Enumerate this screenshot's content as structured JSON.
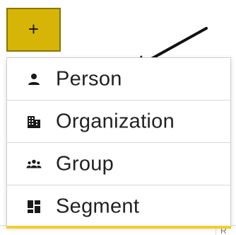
{
  "add_button": {
    "icon": "plus-icon",
    "glyph": "+",
    "color": "#d6b507"
  },
  "menu": {
    "items": [
      {
        "label": "Person",
        "icon": "person-icon"
      },
      {
        "label": "Organization",
        "icon": "building-icon"
      },
      {
        "label": "Group",
        "icon": "group-icon"
      },
      {
        "label": "Segment",
        "icon": "segment-icon"
      }
    ],
    "accent_color": "#f1cf2a"
  },
  "annotation": {
    "type": "arrow",
    "points_to": "Person"
  }
}
